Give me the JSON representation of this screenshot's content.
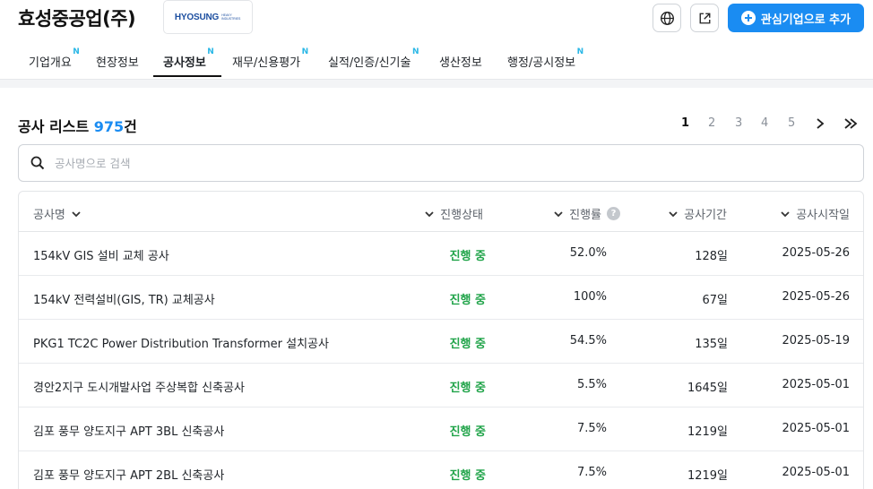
{
  "company": {
    "name": "효성중공업(주)",
    "logo_text": "HYOSUNG",
    "logo_subtext": "HEAVY INDUSTRIES"
  },
  "header": {
    "globe_icon": "globe-icon",
    "share_icon": "external-link-icon",
    "add_button_label": "관심기업으로 추가",
    "accent_color": "#1a8cf2"
  },
  "tabs": [
    {
      "label": "기업개요",
      "badge": "N"
    },
    {
      "label": "현장정보",
      "badge": ""
    },
    {
      "label": "공사정보",
      "badge": "N",
      "active": true
    },
    {
      "label": "재무/신용평가",
      "badge": "N"
    },
    {
      "label": "실적/인증/신기술",
      "badge": "N"
    },
    {
      "label": "생산정보",
      "badge": ""
    },
    {
      "label": "행정/공시정보",
      "badge": "N"
    }
  ],
  "list": {
    "title": "공사 리스트",
    "count": "975",
    "count_suffix": "건"
  },
  "pagination": {
    "pages": [
      "1",
      "2",
      "3",
      "4",
      "5"
    ],
    "current": "1",
    "next_icon": "chevron-right-icon",
    "last_icon": "double-chevron-right-icon"
  },
  "search": {
    "placeholder": "공사명으로 검색",
    "value": ""
  },
  "table": {
    "columns": [
      "공사명",
      "진행상태",
      "진행률",
      "공사기간",
      "공사시작일"
    ],
    "rows": [
      {
        "name": "154kV GIS 설비 교체 공사",
        "status": "진행 중",
        "rate": "52.0%",
        "period": "128일",
        "start": "2025-05-26"
      },
      {
        "name": "154kV 전력설비(GIS, TR) 교체공사",
        "status": "진행 중",
        "rate": "100%",
        "period": "67일",
        "start": "2025-05-26"
      },
      {
        "name": "PKG1 TC2C Power Distribution Transformer 설치공사",
        "status": "진행 중",
        "rate": "54.5%",
        "period": "135일",
        "start": "2025-05-19"
      },
      {
        "name": "경안2지구 도시개발사업 주상복합 신축공사",
        "status": "진행 중",
        "rate": "5.5%",
        "period": "1645일",
        "start": "2025-05-01"
      },
      {
        "name": "김포 풍무 양도지구 APT 3BL 신축공사",
        "status": "진행 중",
        "rate": "7.5%",
        "period": "1219일",
        "start": "2025-05-01"
      },
      {
        "name": "김포 풍무 양도지구 APT 2BL 신축공사",
        "status": "진행 중",
        "rate": "7.5%",
        "period": "1219일",
        "start": "2025-05-01"
      }
    ],
    "status_color": "#21a44a"
  }
}
